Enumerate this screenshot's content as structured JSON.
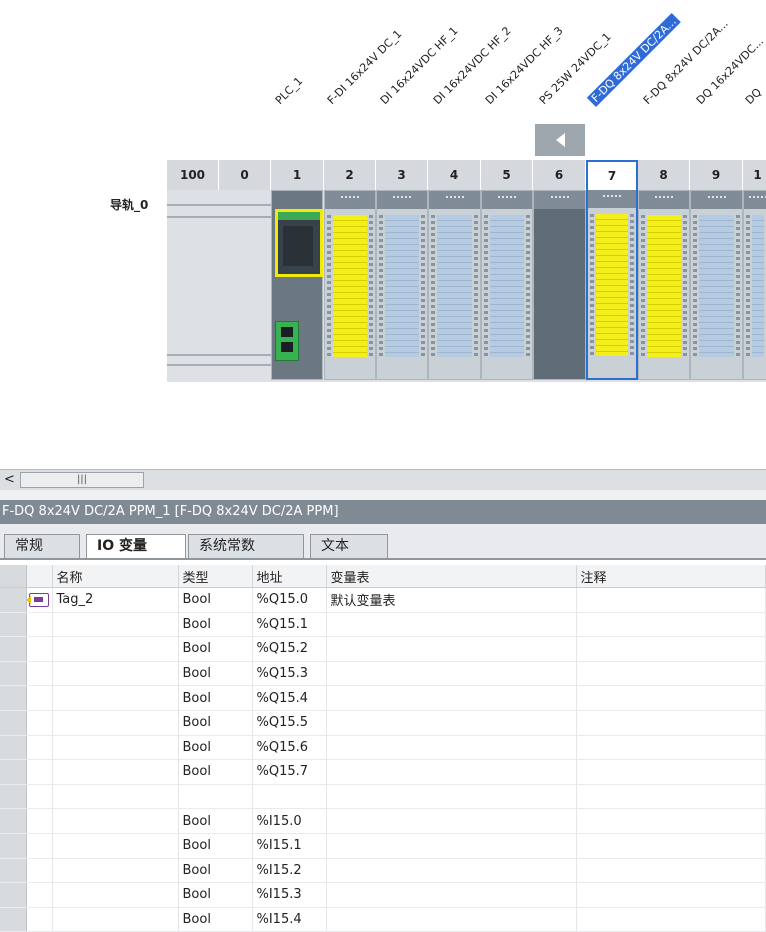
{
  "device_view": {
    "module_labels": [
      {
        "text": "PLC_1"
      },
      {
        "text": "F-DI 16x24V DC_1"
      },
      {
        "text": "DI 16x24VDC HF_1"
      },
      {
        "text": "DI 16x24VDC HF_2"
      },
      {
        "text": "DI 16x24VDC HF_3"
      },
      {
        "text": "PS 25W 24VDC_1"
      },
      {
        "text": "F-DQ 8x24V DC/2A...",
        "selected": true
      },
      {
        "text": "F-DQ 8x24V DC/2A..."
      },
      {
        "text": "DQ 16x24VDC..."
      },
      {
        "text": "DQ"
      }
    ],
    "slot_numbers": [
      "100",
      "0",
      "1",
      "2",
      "3",
      "4",
      "5",
      "6",
      "7",
      "8",
      "9",
      "1"
    ],
    "selected_slot": "7",
    "rail_label": "导轨_0",
    "colors": {
      "selection": "#2a6fd1",
      "fail_safe_yellow": "#f4ee1b",
      "standard_blue": "#b5cbe3"
    }
  },
  "scrollbar": {
    "thumb_glyph": "|||",
    "left_arrow": "<"
  },
  "properties": {
    "title": "F-DQ 8x24V DC/2A PPM_1 [F-DQ 8x24V DC/2A PPM]",
    "tabs": [
      {
        "label": "常规",
        "active": false
      },
      {
        "label": "IO 变量",
        "active": true
      },
      {
        "label": "系统常数",
        "active": false
      },
      {
        "label": "文本",
        "active": false
      }
    ]
  },
  "io_table": {
    "headers": {
      "name": "名称",
      "type": "类型",
      "address": "地址",
      "tag_table": "变量表",
      "comment": "注释"
    },
    "rows": [
      {
        "icon": "tag-output-icon",
        "name": "Tag_2",
        "type": "Bool",
        "address": "%Q15.0",
        "tag_table": "默认变量表",
        "comment": ""
      },
      {
        "icon": "",
        "name": "",
        "type": "Bool",
        "address": "%Q15.1",
        "tag_table": "",
        "comment": ""
      },
      {
        "icon": "",
        "name": "",
        "type": "Bool",
        "address": "%Q15.2",
        "tag_table": "",
        "comment": ""
      },
      {
        "icon": "",
        "name": "",
        "type": "Bool",
        "address": "%Q15.3",
        "tag_table": "",
        "comment": ""
      },
      {
        "icon": "",
        "name": "",
        "type": "Bool",
        "address": "%Q15.4",
        "tag_table": "",
        "comment": ""
      },
      {
        "icon": "",
        "name": "",
        "type": "Bool",
        "address": "%Q15.5",
        "tag_table": "",
        "comment": ""
      },
      {
        "icon": "",
        "name": "",
        "type": "Bool",
        "address": "%Q15.6",
        "tag_table": "",
        "comment": ""
      },
      {
        "icon": "",
        "name": "",
        "type": "Bool",
        "address": "%Q15.7",
        "tag_table": "",
        "comment": ""
      },
      {
        "icon": "",
        "name": "",
        "type": "",
        "address": "",
        "tag_table": "",
        "comment": ""
      },
      {
        "icon": "",
        "name": "",
        "type": "Bool",
        "address": "%I15.0",
        "tag_table": "",
        "comment": ""
      },
      {
        "icon": "",
        "name": "",
        "type": "Bool",
        "address": "%I15.1",
        "tag_table": "",
        "comment": ""
      },
      {
        "icon": "",
        "name": "",
        "type": "Bool",
        "address": "%I15.2",
        "tag_table": "",
        "comment": ""
      },
      {
        "icon": "",
        "name": "",
        "type": "Bool",
        "address": "%I15.3",
        "tag_table": "",
        "comment": ""
      },
      {
        "icon": "",
        "name": "",
        "type": "Bool",
        "address": "%I15.4",
        "tag_table": "",
        "comment": ""
      }
    ]
  }
}
